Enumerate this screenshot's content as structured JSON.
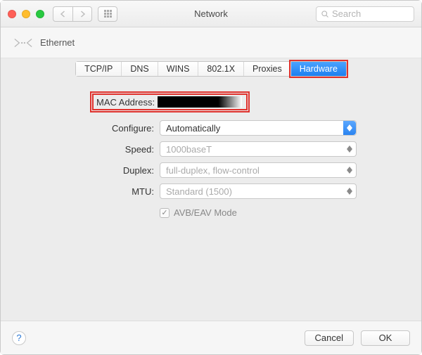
{
  "window": {
    "title": "Network"
  },
  "search": {
    "placeholder": "Search"
  },
  "breadcrumb": {
    "label": "Ethernet"
  },
  "tabs": [
    {
      "label": "TCP/IP",
      "selected": false
    },
    {
      "label": "DNS",
      "selected": false
    },
    {
      "label": "WINS",
      "selected": false
    },
    {
      "label": "802.1X",
      "selected": false
    },
    {
      "label": "Proxies",
      "selected": false
    },
    {
      "label": "Hardware",
      "selected": true
    }
  ],
  "hardware": {
    "mac_label": "MAC Address:",
    "mac_value_redacted": true,
    "configure_label": "Configure:",
    "configure_value": "Automatically",
    "speed_label": "Speed:",
    "speed_value": "1000baseT",
    "duplex_label": "Duplex:",
    "duplex_value": "full-duplex, flow-control",
    "mtu_label": "MTU:",
    "mtu_value": "Standard  (1500)",
    "avb_label": "AVB/EAV Mode",
    "avb_checked": true
  },
  "footer": {
    "cancel": "Cancel",
    "ok": "OK"
  }
}
